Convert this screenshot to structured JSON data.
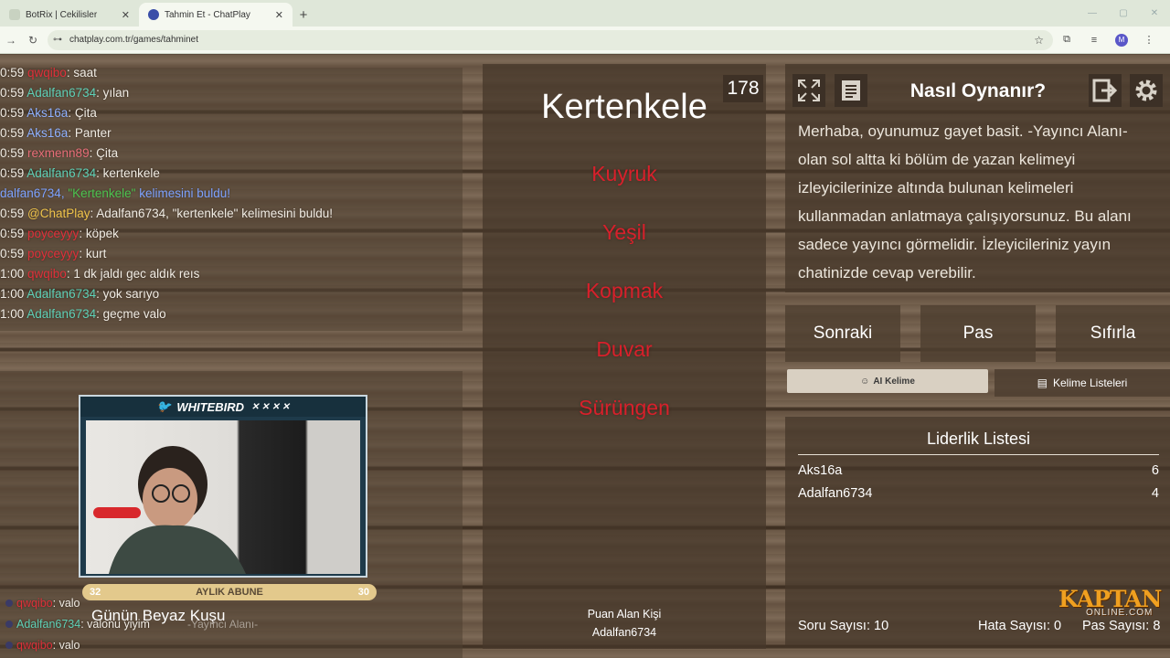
{
  "browser": {
    "tabs": [
      {
        "title": "BotRix | Cekilisler",
        "active": false
      },
      {
        "title": "Tahmin Et - ChatPlay",
        "active": true
      }
    ],
    "url": "chatplay.com.tr/games/tahminet",
    "profile_initial": "M"
  },
  "chat": {
    "messages": [
      {
        "time": "0:59",
        "user": "qwqibo",
        "text": ": saat",
        "color": "red"
      },
      {
        "time": "0:59",
        "user": "Adalfan6734",
        "text": ": yılan",
        "color": "teal"
      },
      {
        "time": "0:59",
        "user": "Aks16a",
        "text": ": Çita",
        "color": "blue"
      },
      {
        "time": "0:59",
        "user": "Aks16a",
        "text": ": Panter",
        "color": "blue"
      },
      {
        "time": "0:59",
        "user": "rexmenn89",
        "text": ": Çita",
        "color": "pink"
      },
      {
        "time": "0:59",
        "user": "Adalfan6734",
        "text": ": kertenkele",
        "color": "teal"
      },
      {
        "time": "",
        "user": "dalfan6734, ",
        "text": " kelimesini buldu!",
        "highlight": "\"Kertenkele\"",
        "color": "ann"
      },
      {
        "time": "0:59",
        "user": "@ChatPlay",
        "text": ": Adalfan6734, \"kertenkele\" kelimesini buldu!",
        "color": "gold"
      },
      {
        "time": "0:59",
        "user": "poyceyyy",
        "text": ": köpek",
        "color": "red"
      },
      {
        "time": "0:59",
        "user": "poyceyyy",
        "text": ": kurt",
        "color": "red"
      },
      {
        "time": "1:00",
        "user": "qwqibo",
        "text": ": 1 dk jaldı gec aldık reıs",
        "color": "red"
      },
      {
        "time": "1:00",
        "user": "Adalfan6734",
        "text": ": yok sarıyo",
        "color": "teal"
      },
      {
        "time": "1:00",
        "user": "Adalfan6734",
        "text": ": geçme valo",
        "color": "teal"
      }
    ],
    "bottom_messages": [
      {
        "user": "qwqibo",
        "text": ": valo",
        "color": "red"
      },
      {
        "user": "Adalfan6734",
        "text": ": valonu yiyim",
        "color": "teal"
      },
      {
        "user": "qwqibo",
        "text": ": valo",
        "color": "red"
      }
    ]
  },
  "game": {
    "word": "Kertenkele",
    "counter": "178",
    "forbidden": [
      "Kuyruk",
      "Yeşil",
      "Kopmak",
      "Duvar",
      "Sürüngen"
    ],
    "scorer_label": "Puan Alan Kişi",
    "scorer_name": "Adalfan6734"
  },
  "howto": {
    "title": "Nasıl Oynanır?",
    "lines": [
      "Merhaba, oyunumuz gayet basit. -Yayıncı Alanı-",
      "olan sol altta ki bölüm de yazan kelimeyi",
      "izleyicilerinize altında bulunan kelimeleri",
      "kullanmadan anlatmaya çalışıyorsunuz. Bu alanı",
      "sadece yayıncı görmelidir. İzleyicileriniz yayın",
      "chatinizde cevap verebilir."
    ]
  },
  "controls": {
    "next": "Sonraki",
    "pass": "Pas",
    "reset": "Sıfırla",
    "ai_word": "AI Kelime",
    "word_lists": "Kelime Listeleri"
  },
  "leaderboard": {
    "title": "Liderlik Listesi",
    "rows": [
      {
        "name": "Aks16a",
        "score": "6"
      },
      {
        "name": "Adalfan6734",
        "score": "4"
      }
    ],
    "questions": "Soru Sayısı: 10",
    "errors": "Hata Sayısı: 0",
    "passes": "Pas Sayısı: 8"
  },
  "overlay": {
    "cam_brand": "WHITEBIRD",
    "sub_left": "32",
    "sub_label": "AYLIK ABUNE",
    "sub_right": "30",
    "bird_text": "Günün Beyaz Kuşu",
    "streamer_area": "-Yayıncı Alanı-",
    "logo": "KAPTAN",
    "logo_sub": "ONLINE.COM"
  },
  "colors": {
    "red": "#e0303a",
    "teal": "#5fd1b7",
    "blue": "#8fb1ff",
    "pink": "#e86d78",
    "gold": "#f0c44a",
    "ann": "#7da2ff",
    "forbidden": "#d8202b"
  }
}
